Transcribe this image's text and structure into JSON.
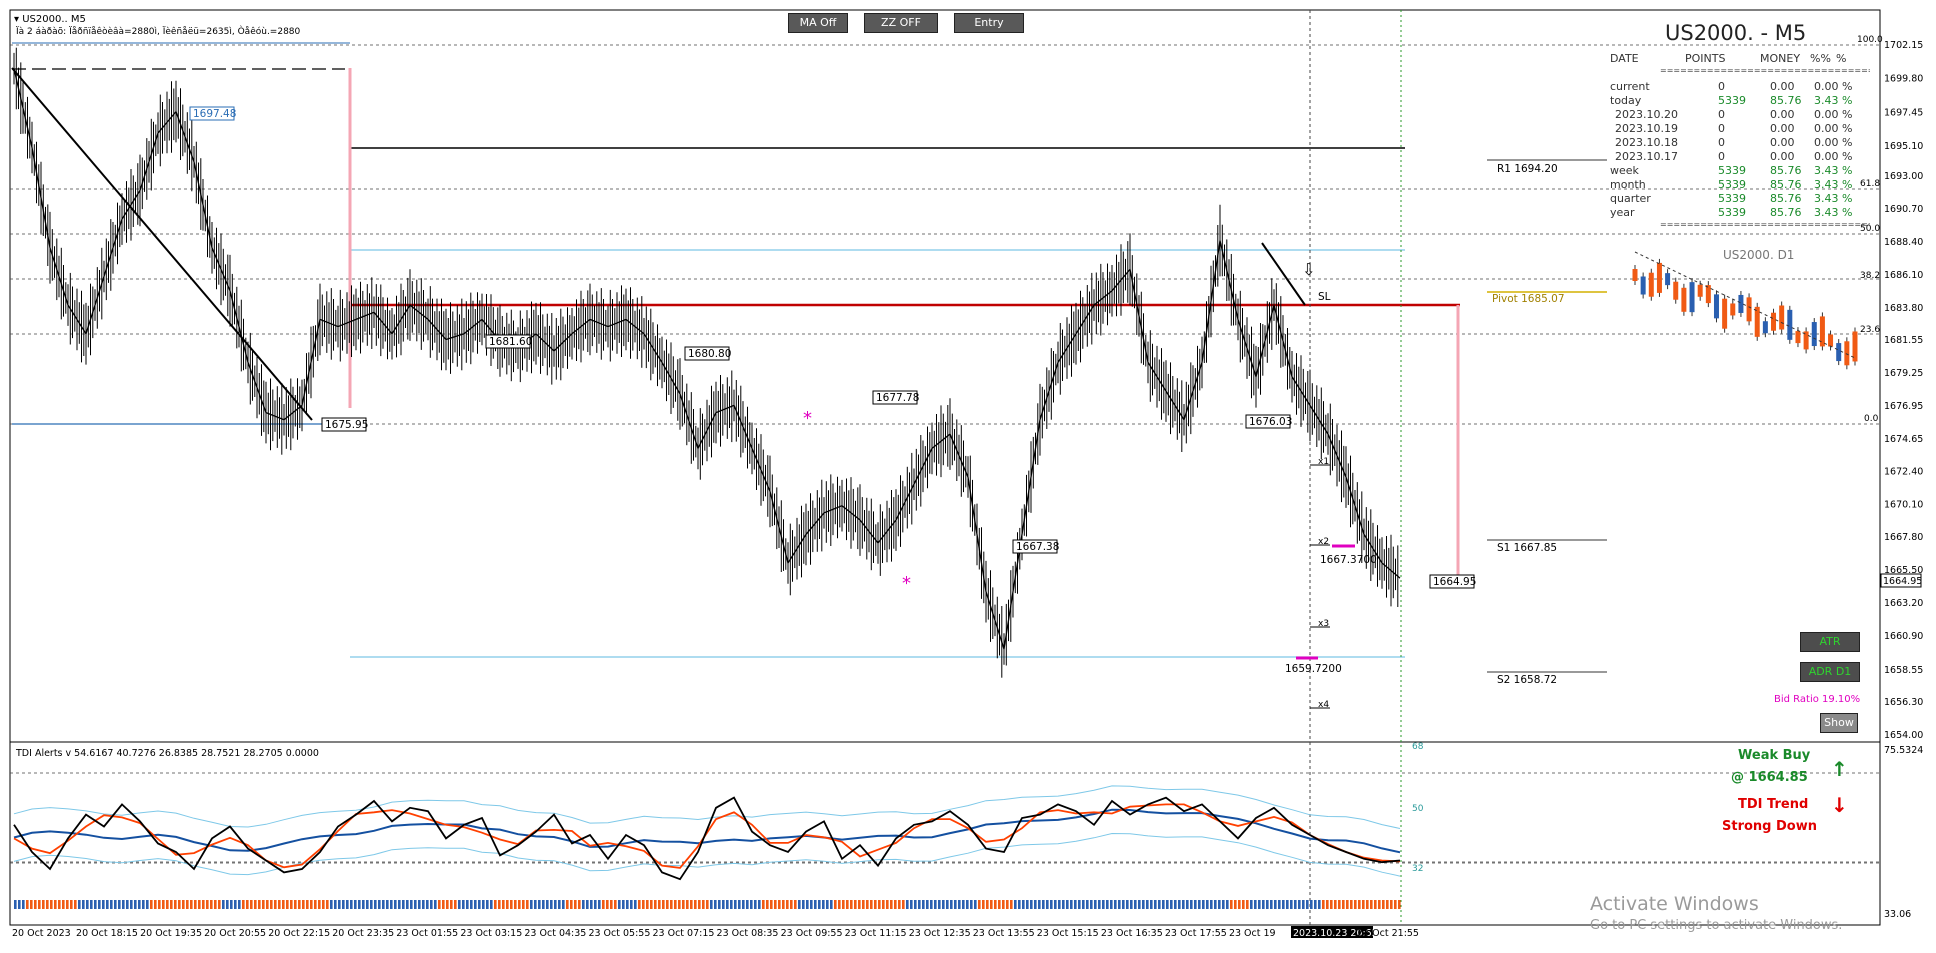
{
  "window": {
    "symbol_title": "US2000.. M5",
    "info_line": "Ïà 2 áàðàõ: Ïåðñïåêòèâà=2880ì, Ïèêñåëü=2635ì, Òåêóù.=2880",
    "chart_title": "US2000. - M5",
    "daily_label": "US2000. D1"
  },
  "buttons": {
    "ma": "MA Off",
    "zz": "ZZ OFF",
    "entry": "Entry",
    "atr": "ATR",
    "adr": "ADR D1",
    "show": "Show"
  },
  "bid_ratio": "Bid Ratio 19.10%",
  "table": {
    "headers": [
      "DATE",
      "POINTS",
      "MONEY",
      "%%",
      "%"
    ],
    "separator": "==========================================",
    "rows": [
      {
        "label": "current",
        "points": "0",
        "money": "0.00",
        "pct": "0.00 %"
      },
      {
        "label": "today",
        "points": "5339",
        "money": "85.76",
        "pct": "3.43 %"
      },
      {
        "label": "2023.10.20",
        "points": "0",
        "money": "0.00",
        "pct": "0.00 %"
      },
      {
        "label": "2023.10.19",
        "points": "0",
        "money": "0.00",
        "pct": "0.00 %"
      },
      {
        "label": "2023.10.18",
        "points": "0",
        "money": "0.00",
        "pct": "0.00 %"
      },
      {
        "label": "2023.10.17",
        "points": "0",
        "money": "0.00",
        "pct": "0.00 %"
      },
      {
        "label": "week",
        "points": "5339",
        "money": "85.76",
        "pct": "3.43 %"
      },
      {
        "label": "month",
        "points": "5339",
        "money": "85.76",
        "pct": "3.43 %"
      },
      {
        "label": "quarter",
        "points": "5339",
        "money": "85.76",
        "pct": "3.43 %"
      },
      {
        "label": "year",
        "points": "5339",
        "money": "85.76",
        "pct": "3.43 %"
      }
    ]
  },
  "signals": {
    "weak_buy": "Weak Buy",
    "weak_buy_price": "@ 1664.85",
    "tdi_trend": "TDI Trend",
    "strong_down": "Strong Down",
    "up_arrow": "up-arrow-icon",
    "down_arrow": "down-arrow-icon"
  },
  "tdi_label": "TDI Alerts v 54.6167 40.7276 26.8385 28.7521 28.2705 0.0000",
  "pivots": {
    "r1": "R1 1694.20",
    "pivot": "Pivot 1685.07",
    "s1": "S1 1667.85",
    "s2": "S2 1658.72"
  },
  "levels": {
    "fib_100": "100.0",
    "fib_618": "61.8",
    "fib_50": "50.0",
    "fib_382": "38.2",
    "fib_236": "23.6",
    "fib_0": "0.0",
    "sl": "SL",
    "x1": "x1",
    "x2": "x2",
    "x3": "x3",
    "x4": "x4"
  },
  "price_labels": {
    "p1697": "1697.48",
    "p1675": "1675.95",
    "p1681": "1681.60",
    "p1680": "1680.80",
    "p1677": "1677.78",
    "p1667": "1667.38",
    "p1676": "1676.03",
    "p1664": "1664.95",
    "p16673700": "1667.3700",
    "p16597200": "1659.7200"
  },
  "current_price": "1664.95",
  "tdi_axis": {
    "top": "75.5324",
    "l68": "68",
    "l50": "50",
    "l32": "32"
  },
  "bottom_right": "33.06",
  "activate": {
    "line1": "Activate Windows",
    "line2": "Go to PC settings to activate Windows."
  },
  "colors": {
    "bull": "#000000",
    "pivot": "#d4b000",
    "red_line": "#c00000",
    "pink": "#f4a6b4",
    "tdi_red": "#ff4000",
    "tdi_blue": "#1450a0",
    "band": "#7ec8e8",
    "green_text": "#1a8a2a",
    "red_text": "#e00000",
    "magenta": "#e000c0"
  },
  "chart_data": {
    "type": "line",
    "title": "US2000. - M5",
    "xlabel": "",
    "ylabel": "",
    "ylim": [
      1654.0,
      1702.15
    ],
    "x_ticks": [
      "20 Oct 2023",
      "20 Oct 18:15",
      "20 Oct 19:35",
      "20 Oct 20:55",
      "20 Oct 22:15",
      "20 Oct 23:35",
      "23 Oct 01:55",
      "23 Oct 03:15",
      "23 Oct 04:35",
      "23 Oct 05:55",
      "23 Oct 07:15",
      "23 Oct 08:35",
      "23 Oct 09:55",
      "23 Oct 11:15",
      "23 Oct 12:35",
      "23 Oct 13:55",
      "23 Oct 15:15",
      "23 Oct 16:35",
      "23 Oct 17:55",
      "23 Oct 19",
      "2023.10.23 20:55",
      "23 Oct 21:55"
    ],
    "y_ticks": [
      "1702.15",
      "1699.80",
      "1697.45",
      "1695.10",
      "1693.00",
      "1690.70",
      "1688.40",
      "1686.10",
      "1683.80",
      "1681.55",
      "1679.25",
      "1676.95",
      "1674.65",
      "1672.40",
      "1670.10",
      "1667.80",
      "1665.50",
      "1663.20",
      "1660.90",
      "1658.55",
      "1656.30",
      "1654.00"
    ],
    "series": [
      {
        "values": [
          1700.5,
          1695.0,
          1688.0,
          1684.0,
          1682.0,
          1686.0,
          1690.0,
          1692.0,
          1696.0,
          1697.5,
          1694.0,
          1688.0,
          1685.0,
          1680.0,
          1676.5,
          1676.0,
          1677.0,
          1683.0,
          1682.5,
          1683.0,
          1683.5,
          1682.0,
          1684.0,
          1683.0,
          1681.6,
          1682.0,
          1683.0,
          1681.5,
          1681.0,
          1682.0,
          1680.8,
          1682.0,
          1683.0,
          1682.5,
          1683.0,
          1682.0,
          1680.0,
          1677.8,
          1674.0,
          1676.5,
          1677.0,
          1674.0,
          1671.0,
          1666.0,
          1668.0,
          1669.5,
          1670.0,
          1669.0,
          1667.4,
          1669.0,
          1671.5,
          1674.0,
          1675.0,
          1672.0,
          1664.0,
          1660.0,
          1668.0,
          1676.0,
          1680.0,
          1682.0,
          1684.0,
          1685.0,
          1686.5,
          1680.0,
          1678.0,
          1676.0,
          1680.0,
          1688.5,
          1683.0,
          1679.0,
          1684.0,
          1679.0,
          1677.0,
          1675.0,
          1672.0,
          1668.0,
          1666.0,
          1664.95
        ]
      },
      {
        "name": "TDI Alerts",
        "values": [
          56,
          40,
          30,
          48,
          62,
          55,
          68,
          58,
          45,
          40,
          30,
          48,
          55,
          42,
          35,
          28,
          30,
          40,
          55,
          62,
          70,
          58,
          66,
          64,
          48,
          56,
          60,
          38,
          44,
          52,
          62,
          45,
          50,
          36,
          50,
          44,
          28,
          24,
          40,
          66,
          72,
          52,
          44,
          40,
          52,
          58,
          36,
          44,
          32,
          48,
          56,
          58,
          64,
          56,
          42,
          40,
          60,
          62,
          68,
          64,
          56,
          70,
          62,
          68,
          72,
          64,
          68,
          58,
          48,
          60,
          66,
          56,
          50,
          44,
          40,
          36,
          34,
          35
        ]
      }
    ],
    "annotations": [
      "1697.48",
      "1675.95",
      "1681.60",
      "1680.80",
      "1677.78",
      "1667.38",
      "1676.03",
      "1664.95",
      "1667.3700",
      "1659.7200"
    ]
  }
}
